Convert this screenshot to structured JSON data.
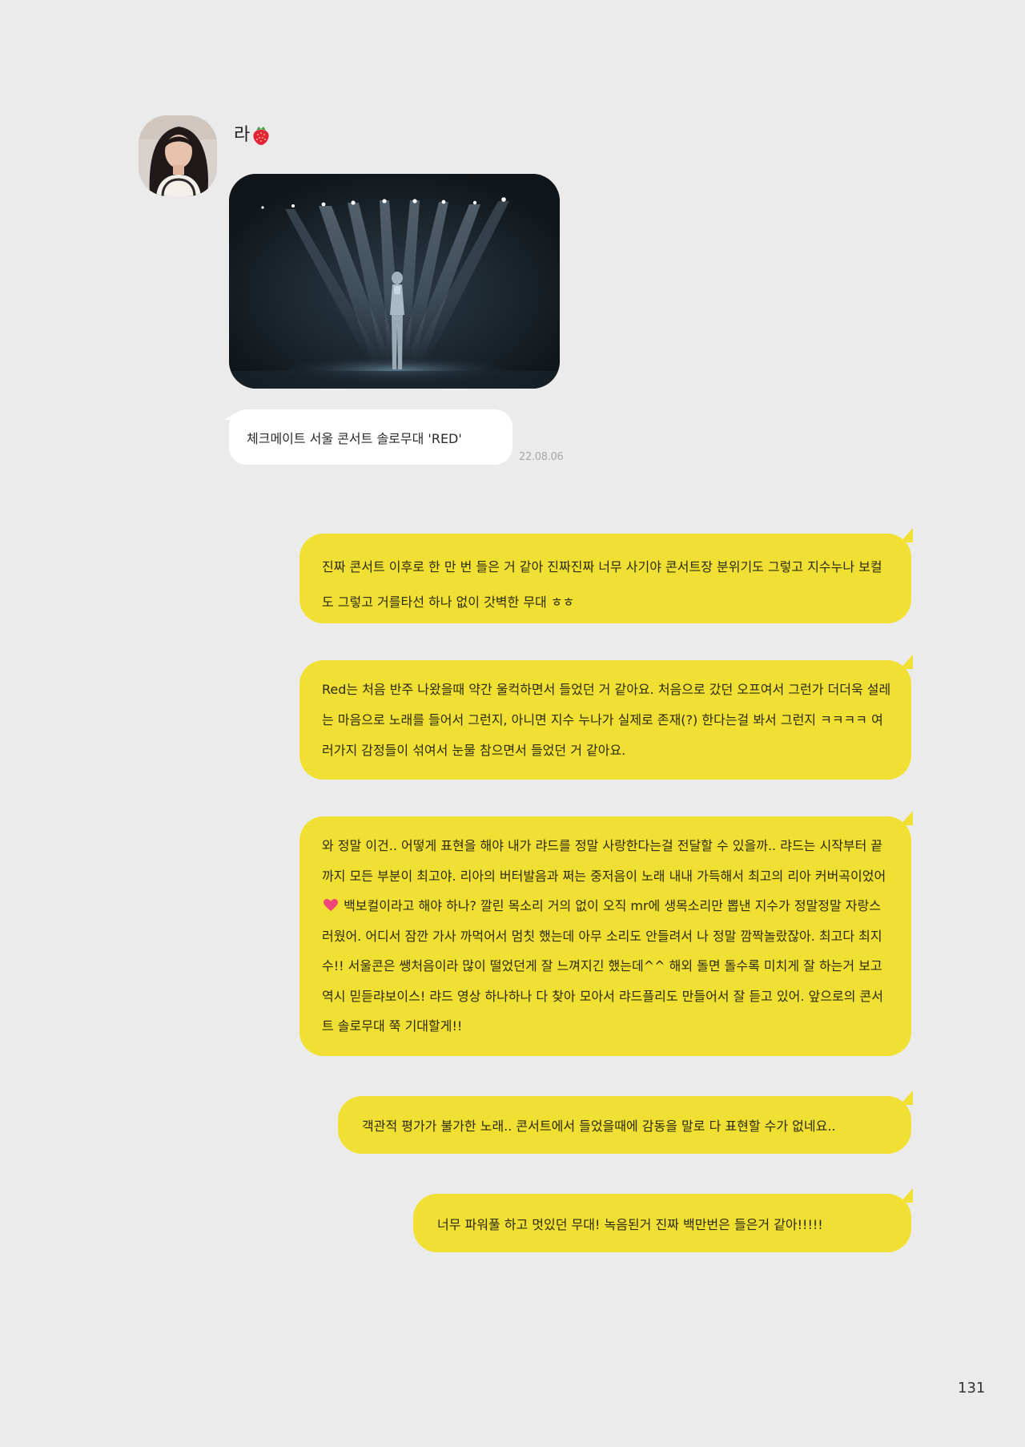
{
  "sender": {
    "name": "라"
  },
  "photo_message": {
    "caption": "체크메이트 서울 콘서트 솔로무대 'RED'",
    "timestamp": "22.08.06"
  },
  "replies": [
    {
      "text": "진짜 콘서트 이후로 한 만 번 들은 거 같아 진짜진짜 너무 사기야 콘서트장 분위기도 그렇고 지수누나 보컬도 그렇고 거를타선 하나 없이 갓벽한 무대 ㅎㅎ"
    },
    {
      "text": "Red는 처음 반주 나왔을때 약간 울컥하면서 들었던 거 같아요. 처음으로 갔던 오프여서 그런가 더더욱 설레는 마음으로 노래를 들어서 그런지, 아니면 지수 누나가 실제로 존재(?) 한다는걸 봐서 그런지 ㅋㅋㅋㅋ 여러가지 감정들이 섞여서 눈물 참으면서 들었던 거 같아요."
    },
    {
      "text_before_heart": "와 정말 이건.. 어떻게 표현을 해야 내가 랴드를 정말 사랑한다는걸 전달할 수 있을까.. 랴드는 시작부터 끝까지 모든 부분이 최고야. 리아의 버터발음과 쩌는 중저음이 노래 내내 가득해서 최고의 리아 커버곡이었어",
      "text_after_heart": " 백보컬이라고 해야 하나? 깔린 목소리 거의 없이 오직 mr에 생목소리만 뽑낸 지수가 정말정말 자랑스러웠어. 어디서 잠깐 가사 까먹어서 멈칫 했는데 아무 소리도 안들려서 나 정말 깜짝놀랐잖아. 최고다 최지수!! 서울콘은 쌩처음이라 많이 떨었던게 잘 느껴지긴 했는데^^ 해외 돌면 돌수록 미치게 잘 하는거 보고 역시 믿듣랴보이스! 랴드 영상 하나하나 다 찾아 모아서 랴드플리도 만들어서 잘 듣고 있어. 앞으로의 콘서트 솔로무대 쭉 기대할게!!"
    },
    {
      "text": "객관적 평가가 불가한 노래.. 콘서트에서 들었을때에 감동을 말로 다 표현할 수가 없네요.."
    },
    {
      "text": "너무 파워풀 하고 멋있던 무대! 녹음된거 진짜 백만번은 들은거 같아!!!!!"
    }
  ],
  "page_number": "131",
  "colors": {
    "background": "#ebebeb",
    "bubble_yellow": "#f1e034",
    "bubble_white": "#ffffff",
    "timestamp": "#a8a8a8"
  },
  "icons": {
    "name_suffix": "strawberry-icon",
    "inline": "heart-icon"
  }
}
